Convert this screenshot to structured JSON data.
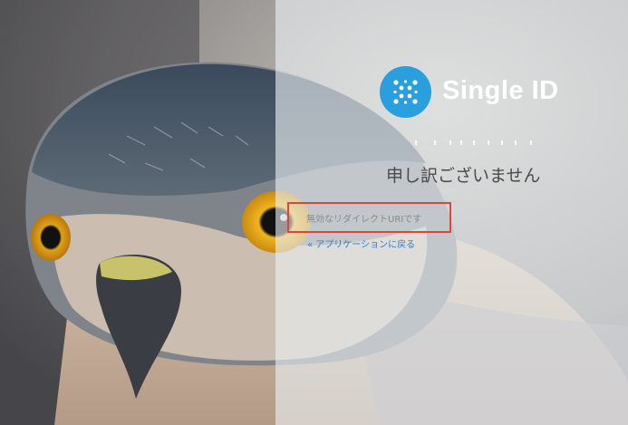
{
  "brand": {
    "name": "Single ID",
    "logo_color": "#2a9fde",
    "icon": "single-id-logo-icon"
  },
  "error": {
    "title": "申し訳ございません",
    "message": "無効なリダイレクトURIです",
    "highlight_color": "#e0453b"
  },
  "links": {
    "back_to_app": "« アプリケーションに戻る",
    "link_color": "#2a80c8"
  },
  "background": {
    "subject": "hawk-photo"
  }
}
